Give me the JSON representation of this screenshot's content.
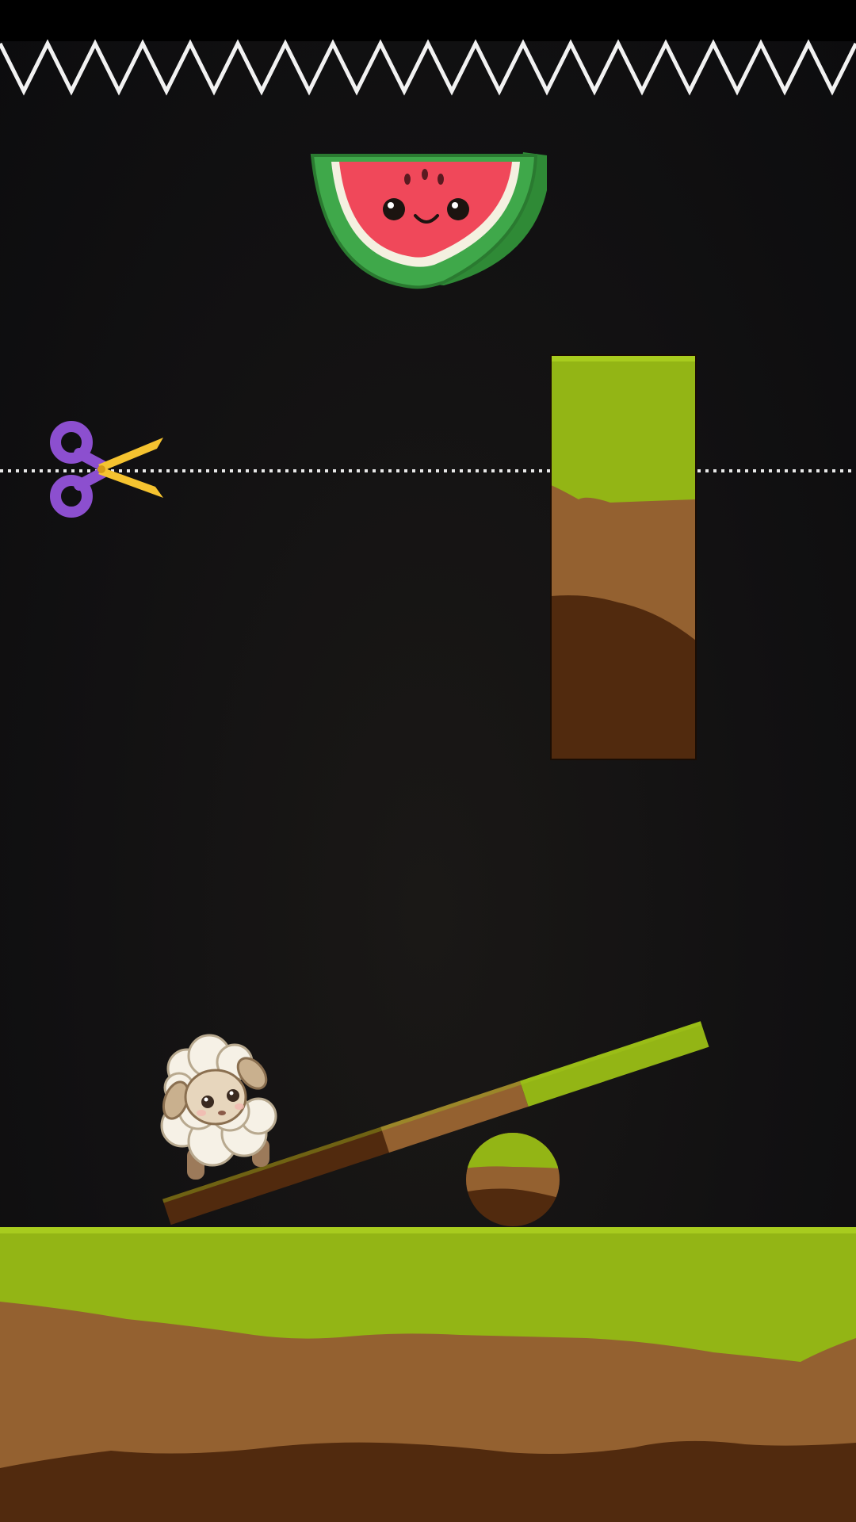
{
  "game": {
    "hazard": "spike-row",
    "target": "watermelon",
    "player": "sheep",
    "tool": "scissors",
    "cut_line": "dotted",
    "objects": [
      "grass-dirt-pillar",
      "seesaw-plank",
      "grass-dirt-ball",
      "ground"
    ]
  },
  "colors": {
    "background": "#121112",
    "grass": "#93b515",
    "grass_light": "#a8cc1e",
    "dirt_light": "#946130",
    "dirt_dark": "#512a0e",
    "spikes": "#f2f2f2",
    "watermelon_flesh": "#f0485a",
    "watermelon_rind": "#3fa84a",
    "scissors_handle": "#8c4fcf",
    "scissors_blade": "#f5c330"
  }
}
